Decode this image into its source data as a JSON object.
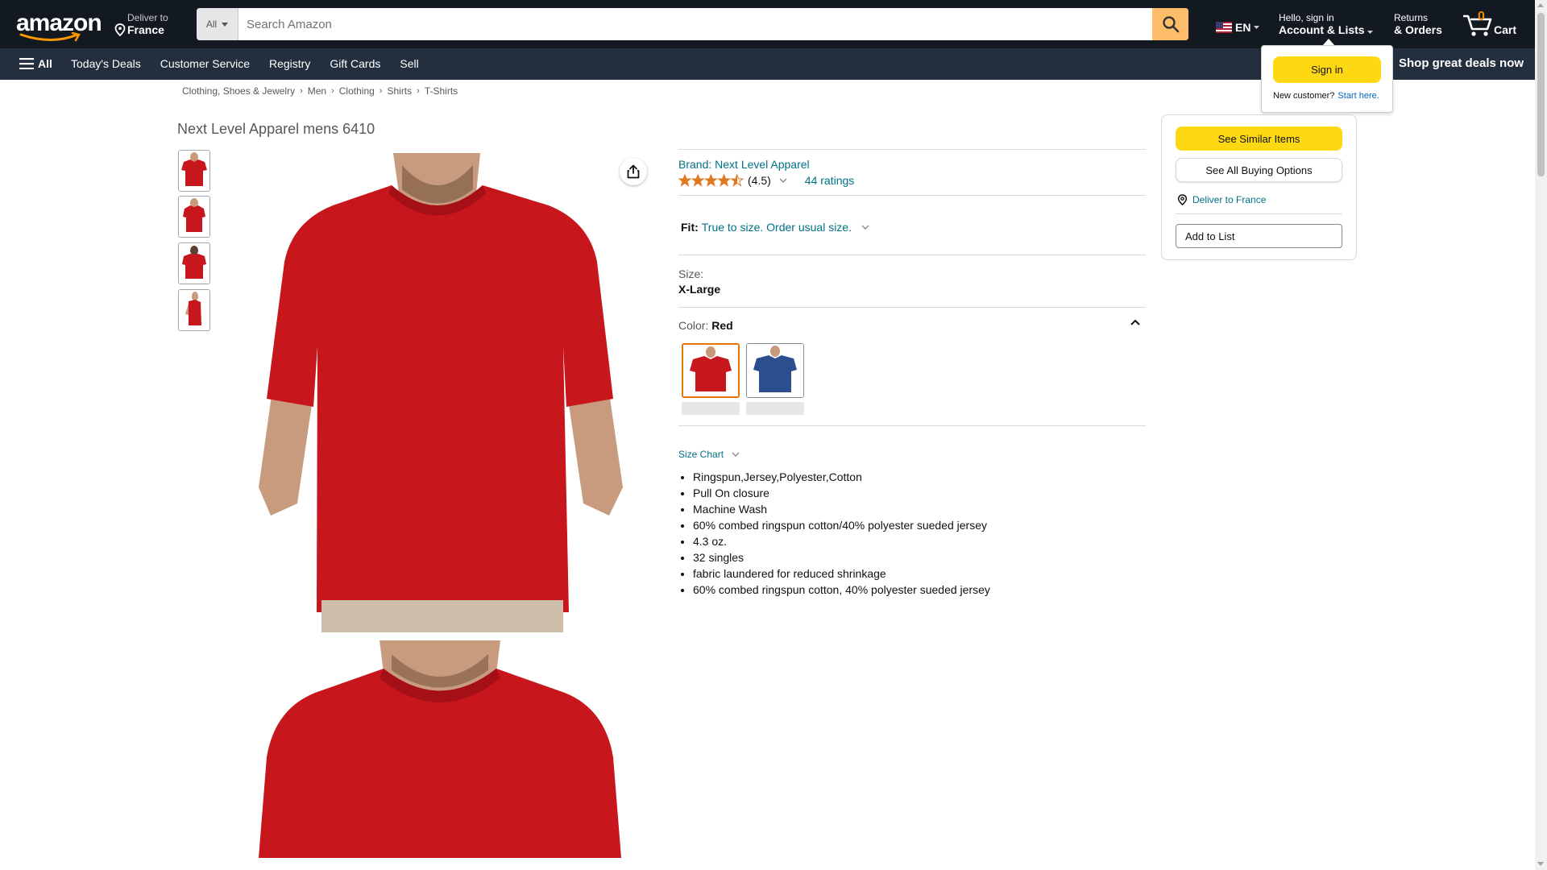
{
  "header": {
    "logo_text": "amazon",
    "deliver_line1": "Deliver to",
    "deliver_line2": "France",
    "search_category": "All",
    "search_placeholder": "Search Amazon",
    "language": "EN",
    "account_line1": "Hello, sign in",
    "account_line2": "Account & Lists",
    "returns_line1": "Returns",
    "returns_line2": "& Orders",
    "cart_count": "0",
    "cart_label": "Cart"
  },
  "subnav": {
    "all_label": "All",
    "links": [
      "Today's Deals",
      "Customer Service",
      "Registry",
      "Gift Cards",
      "Sell"
    ],
    "promo": "Shop great deals now"
  },
  "signin_flyout": {
    "button": "Sign in",
    "new_customer": "New customer?",
    "start_here": "Start here."
  },
  "breadcrumb": [
    "Clothing, Shoes & Jewelry",
    "Men",
    "Clothing",
    "Shirts",
    "T-Shirts"
  ],
  "product": {
    "title": "Next Level Apparel mens 6410",
    "brand": "Brand: Next Level Apparel",
    "rating": "(4.5)",
    "rating_value": 4.5,
    "ratings_count": "44 ratings",
    "fit_label": "Fit:",
    "fit_value": "True to size. Order usual size.",
    "size_label": "Size:",
    "size_value": "X-Large",
    "color_label": "Color:",
    "color_value": "Red",
    "swatch_colors": [
      "#c8161d",
      "#2b4f8e"
    ],
    "size_chart": "Size Chart",
    "bullets": [
      "Ringspun,Jersey,Polyester,Cotton",
      "Pull On closure",
      "Machine Wash",
      "60% combed ringspun cotton/40% polyester sueded jersey",
      "4.3 oz.",
      "32 singles",
      "fabric laundered for reduced shrinkage",
      "60% combed ringspun cotton, 40% polyester sueded jersey"
    ]
  },
  "buybox": {
    "similar": "See Similar Items",
    "buying_options": "See All Buying Options",
    "deliver": "Deliver to France",
    "add_to_list": "Add to List"
  },
  "colors": {
    "nav_dark": "#131921",
    "nav_secondary": "#232f3e",
    "accent_yellow": "#ffd814",
    "search_orange": "#febd69",
    "link_teal": "#007185",
    "shirt_red": "#c8161d"
  }
}
